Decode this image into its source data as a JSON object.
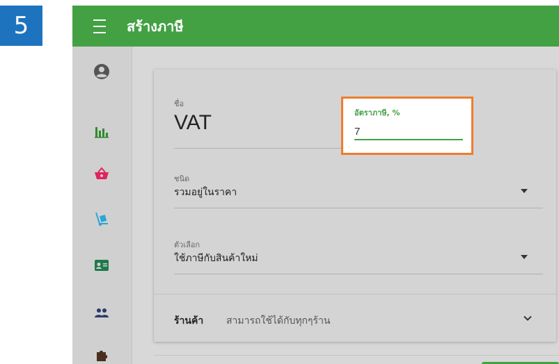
{
  "step_number": "5",
  "topbar": {
    "title": "สร้างภาษี"
  },
  "sidebar": {
    "icons": [
      "account-circle-icon",
      "bar-chart-icon",
      "shopping-basket-icon",
      "hand-truck-icon",
      "contact-card-icon",
      "people-icon",
      "puzzle-icon"
    ]
  },
  "form": {
    "name_label": "ชื่อ",
    "name_value": "VAT",
    "rate_label": "อัตราภาษี, %",
    "rate_value": "7",
    "type_label": "ชนิด",
    "type_value": "รวมอยู่ในราคา",
    "option_label": "ตัวเลือก",
    "option_value": "ใช้ภาษีกับสินค้าใหม่",
    "store_label": "ร้านค้า",
    "store_value": "สามารถใช้ได้กับทุกๆร้าน"
  },
  "colors": {
    "topbar": "#43a043",
    "highlight_border": "#ee7d2b",
    "step_badge": "#1e73be",
    "icon_green": "#2e8b2e",
    "icon_red": "#e0245e",
    "icon_blue": "#2aa6d6",
    "icon_dark_green": "#1f7a4a",
    "icon_navy": "#2a3b6b"
  }
}
